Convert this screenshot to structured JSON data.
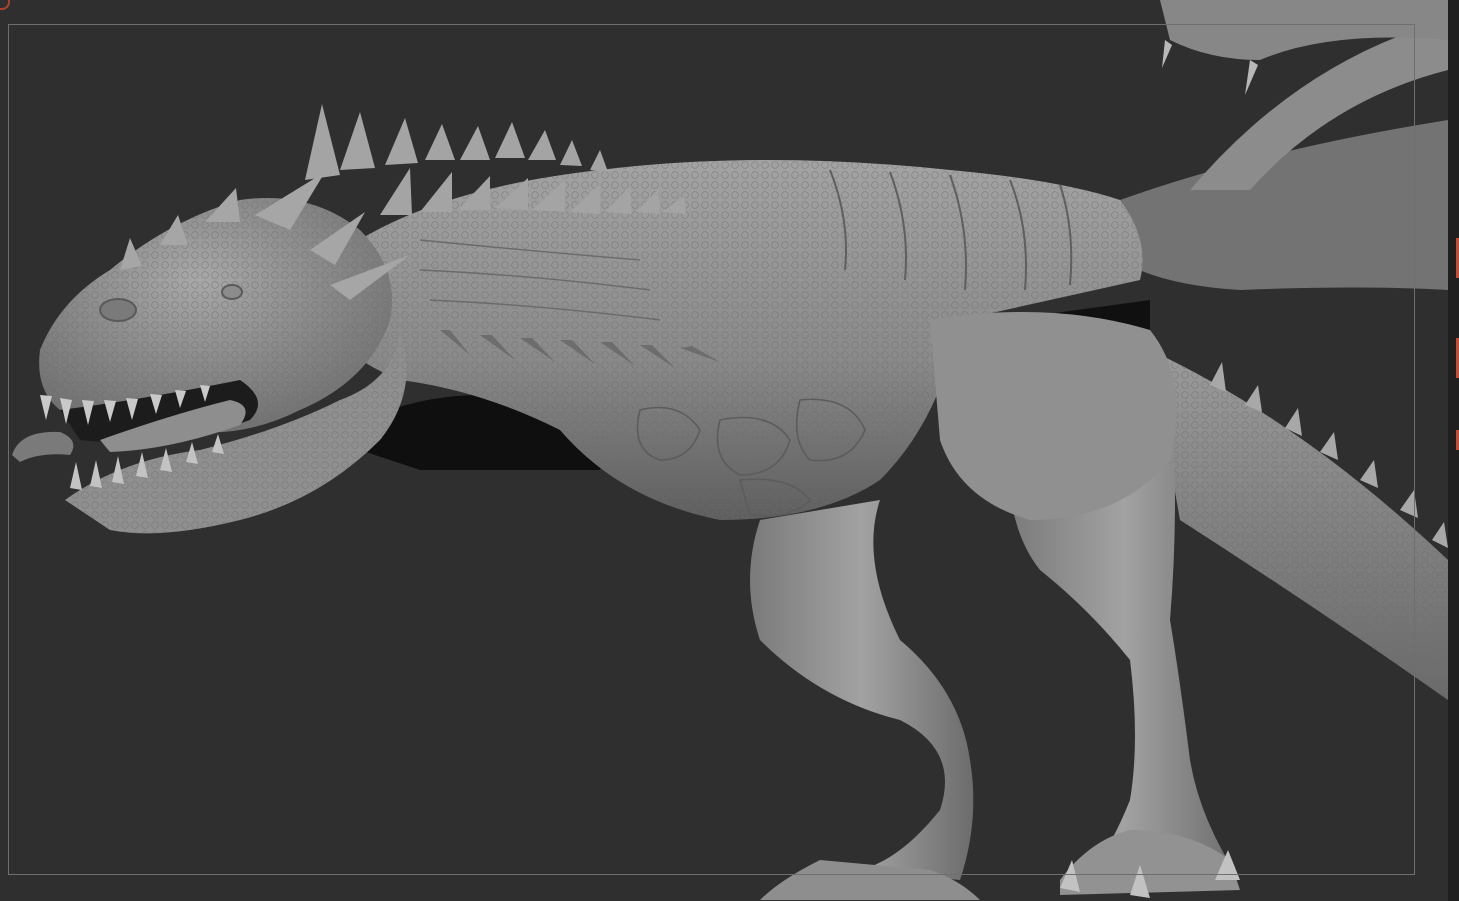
{
  "app": {
    "viewport_label": "",
    "background_color": "#2f2f2f",
    "model_color": "#8a8a8a",
    "frame_color": "#6e6e6e",
    "accent_color": "#c0503a"
  },
  "scene": {
    "subject": "sculpted-creature-model"
  }
}
